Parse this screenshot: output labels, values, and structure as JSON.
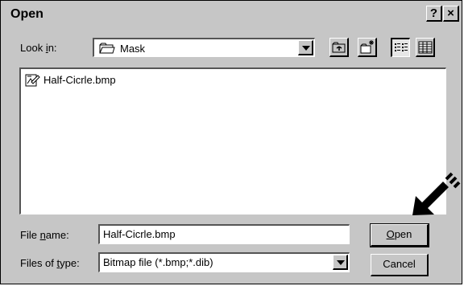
{
  "window": {
    "title": "Open"
  },
  "titlebar": {
    "help_label": "?",
    "close_label": "×"
  },
  "lookin": {
    "label_pre": "Look ",
    "label_u": "i",
    "label_post": "n:",
    "value": "Mask"
  },
  "toolbar": [
    "up-one-level",
    "create-new-folder",
    "list-view",
    "details-view"
  ],
  "files": [
    {
      "name": "Half-Cicrle.bmp"
    }
  ],
  "filename": {
    "label_pre": "File ",
    "label_u": "n",
    "label_post": "ame:",
    "value": "Half-Cicrle.bmp"
  },
  "filetype": {
    "label_pre": "Files of ",
    "label_u": "t",
    "label_post": "ype:",
    "value": "Bitmap file (*.bmp;*.dib)"
  },
  "buttons": {
    "open_u": "O",
    "open_rest": "pen",
    "cancel": "Cancel"
  },
  "icons": {
    "folder": "folder-icon",
    "file": "bitmap-file-icon",
    "pointer": "arrow-pointer-icon"
  }
}
